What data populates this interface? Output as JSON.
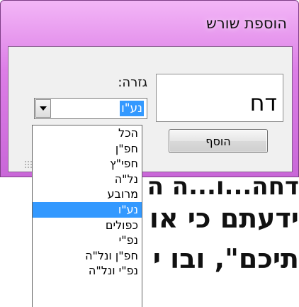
{
  "document": {
    "lines": [
      "דחה...ו...ה ה",
      "ידעתם כי או ה",
      "תיכם\", ובו י ה ת"
    ]
  },
  "dialog": {
    "title": "הוספת שורש",
    "root_value": "דח",
    "gizra_label": "גזרה:",
    "selected_gizra": "נע\"ו",
    "add_button": "הוסף"
  },
  "dropdown": {
    "items": [
      "הכל",
      "חפ\"ן",
      "חפי\"ץ",
      "נל\"ה",
      "מרובע",
      "נע\"ו",
      "כפולים",
      "נפ\"י",
      "חפ\"ן ונל\"ה",
      "נפ\"י ונל\"ה"
    ],
    "selected_index": 5
  },
  "colors": {
    "title_bar": "#dc7ee6",
    "selection": "#3399ff"
  }
}
